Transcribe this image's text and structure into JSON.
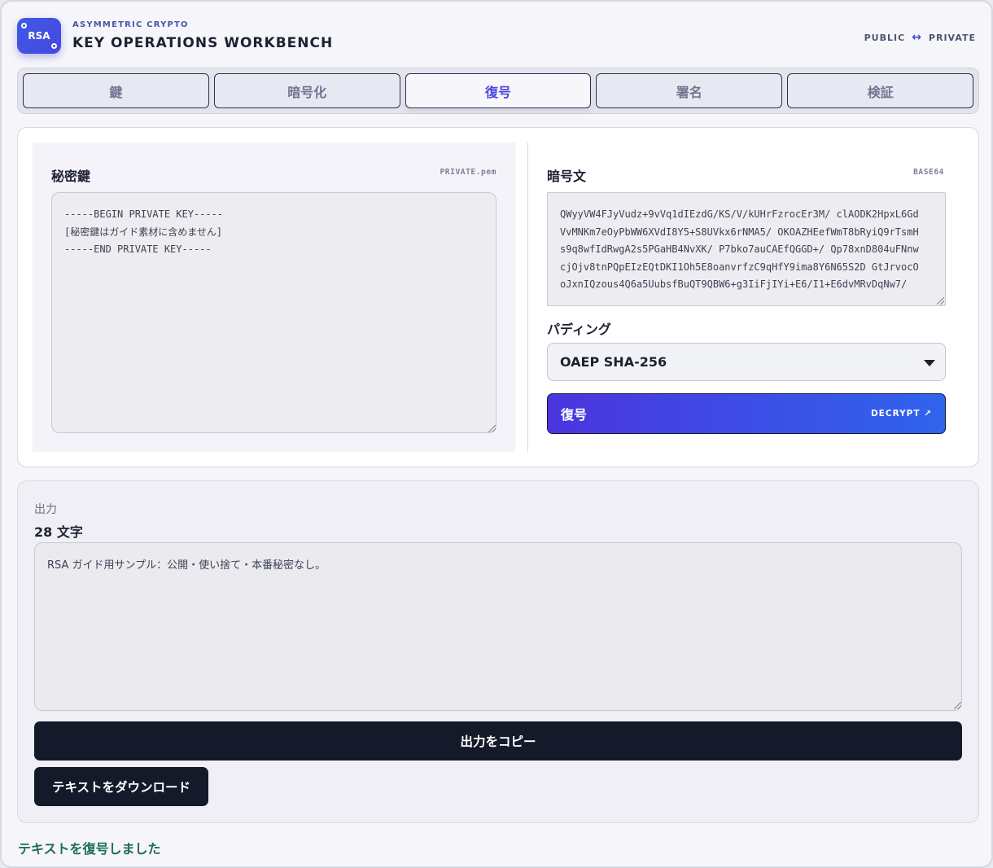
{
  "header": {
    "logo_text": "RSA",
    "kicker": "ASYMMETRIC CRYPTO",
    "title": "KEY OPERATIONS WORKBENCH",
    "direction_left": "PUBLIC",
    "direction_arrow": "↔",
    "direction_right": "PRIVATE"
  },
  "tabs": [
    {
      "label": "鍵",
      "active": false
    },
    {
      "label": "暗号化",
      "active": false
    },
    {
      "label": "復号",
      "active": true
    },
    {
      "label": "署名",
      "active": false
    },
    {
      "label": "検証",
      "active": false
    }
  ],
  "private_key": {
    "label": "秘密鍵",
    "hint": "PRIVATE.pem",
    "value": "-----BEGIN PRIVATE KEY-----\n[秘密鍵はガイド素材に含めません]\n-----END PRIVATE KEY-----"
  },
  "ciphertext": {
    "label": "暗号文",
    "hint": "BASE64",
    "value": "QWyyVW4FJyVudz+9vVq1dIEzdG/KS/V/kUHrFzrocEr3M/ clAODK2HpxL6GdVvMNKm7eOyPbWW6XVdI8Y5+S8UVkx6rNMA5/ OKOAZHEefWmT8bRyiQ9rTsmHs9q8wfIdRwgA2s5PGaHB4NvXK/ P7bko7auCAEfQGGD+/ Qp78xnD804uFNnwcjOjv8tnPQpEIzEQtDKI1Oh5E8oanvrfzC9qHfY9ima8Y6N65S2D GtJrvocOoJxnIQzous4Q6a5UubsfBuQT9QBW6+g3IiFjIYi+E6/I1+E6dvMRvDqNw7/"
  },
  "padding": {
    "label": "パディング",
    "selected": "OAEP SHA-256"
  },
  "decrypt_button": {
    "label": "復号",
    "sub_label": "DECRYPT ↗"
  },
  "output": {
    "label": "出力",
    "count": "28 文字",
    "value": "RSA ガイド用サンプル：公開・使い捨て・本番秘密なし。",
    "copy_label": "出力をコピー",
    "download_label": "テキストをダウンロード"
  },
  "status": "テキストを復号しました"
}
